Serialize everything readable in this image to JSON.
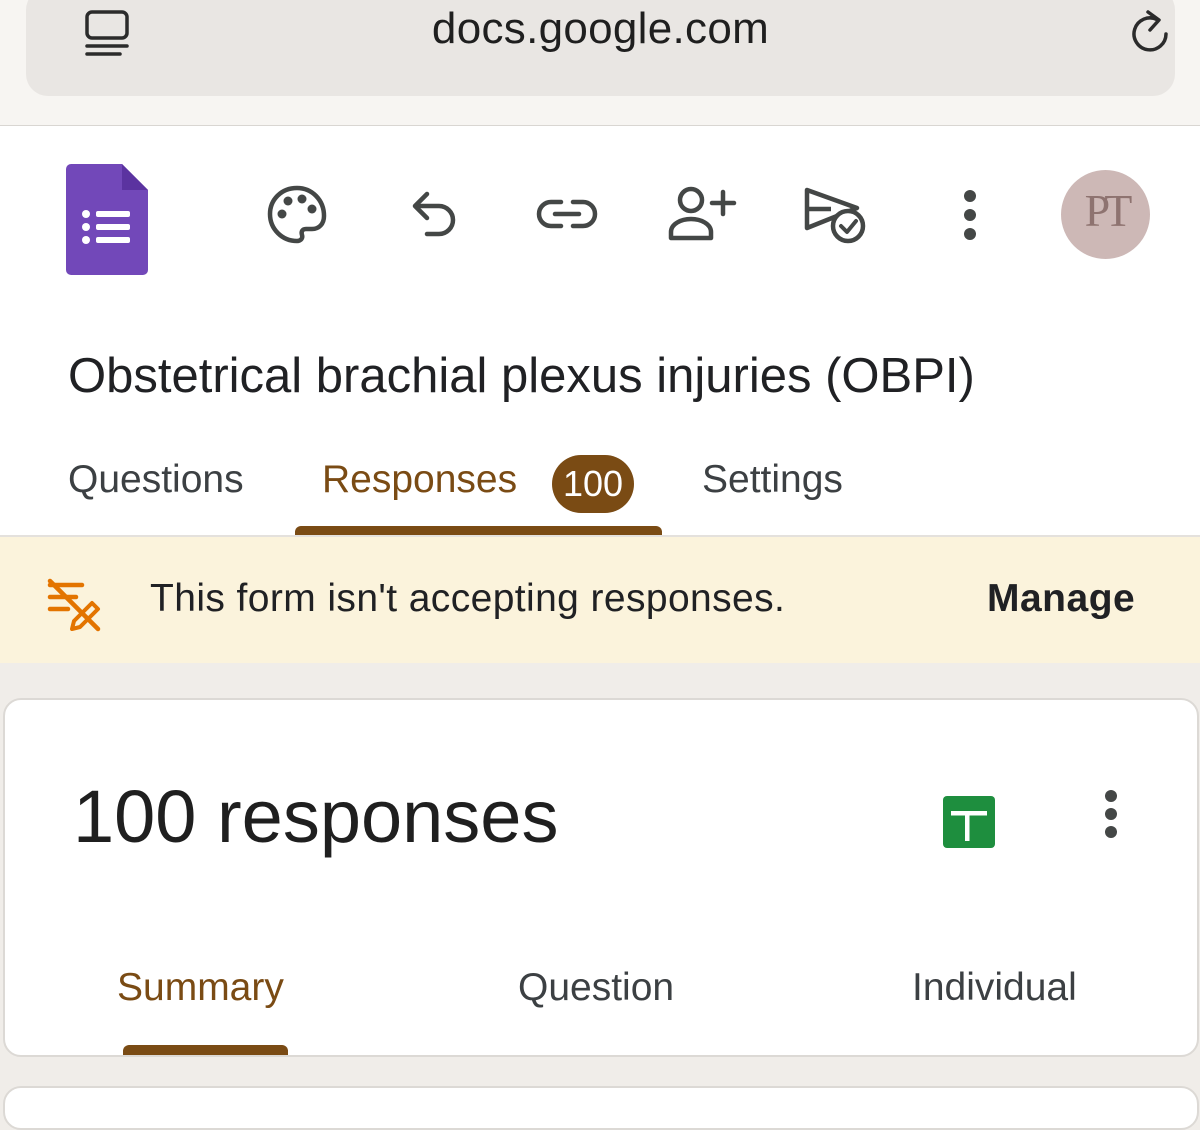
{
  "browser": {
    "url": "docs.google.com"
  },
  "toolbar": {
    "icons": [
      "palette-icon",
      "undo-icon",
      "link-icon",
      "add-collaborator-icon",
      "publish-icon",
      "more-vert-icon"
    ]
  },
  "avatar": {
    "monogram": "PT"
  },
  "form": {
    "title": "Obstetrical brachial plexus injuries (OBPI)"
  },
  "tabs": [
    {
      "label": "Questions",
      "active": false
    },
    {
      "label": "Responses",
      "active": true,
      "badge": "100"
    },
    {
      "label": "Settings",
      "active": false
    }
  ],
  "banner": {
    "message": "This form isn't accepting responses.",
    "action": "Manage"
  },
  "responses": {
    "title": "100 responses",
    "subtabs": [
      {
        "label": "Summary",
        "active": true
      },
      {
        "label": "Question",
        "active": false
      },
      {
        "label": "Individual",
        "active": false
      }
    ]
  },
  "colors": {
    "accent": "#7a4b14",
    "forms_purple": "#673ab7",
    "sheets_green": "#1e8e3e",
    "banner_bg": "#fbf3dc",
    "banner_icon": "#e37400"
  }
}
